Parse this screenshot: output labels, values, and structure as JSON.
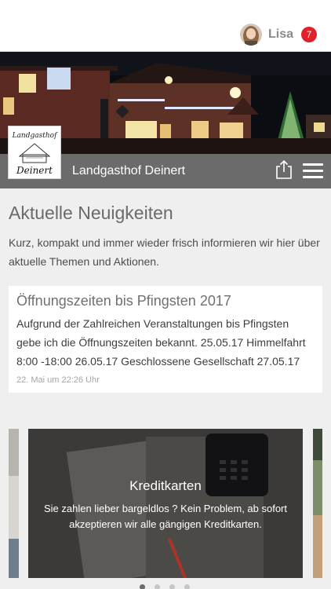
{
  "header": {
    "user_name": "Lisa",
    "notification_count": "7"
  },
  "site": {
    "title": "Landgasthof Deinert",
    "logo_text_top": "Landgasthof",
    "logo_text_bottom": "Deinert"
  },
  "main": {
    "section_title": "Aktuelle Neuigkeiten",
    "intro": "Kurz, kompakt und immer wieder frisch informieren wir hier über aktuelle Themen und Aktionen."
  },
  "news": [
    {
      "title": "Öffnungszeiten bis Pfingsten 2017",
      "body": "Aufgrund der Zahlreichen Veranstaltungen bis Pfingsten gebe ich die Öffnungszeiten bekannt. 25.05.17 Himmelfahrt 8:00 -18:00 26.05.17 Geschlossene Gesellschaft 27.05.17",
      "date": "22. Mai um 22:26 Uhr"
    }
  ],
  "carousel": {
    "title": "Kreditkarten",
    "text": "Sie zahlen lieber bargeldlos ? Kein Problem, ab sofort akzeptieren wir alle gängigen Kreditkarten.",
    "active_index": 0,
    "dot_count": 4
  },
  "colors": {
    "badge": "#e0202a",
    "titlebar": "#6b6b6b",
    "background": "#efefef"
  },
  "icons": [
    "share-icon",
    "hamburger-menu-icon"
  ]
}
